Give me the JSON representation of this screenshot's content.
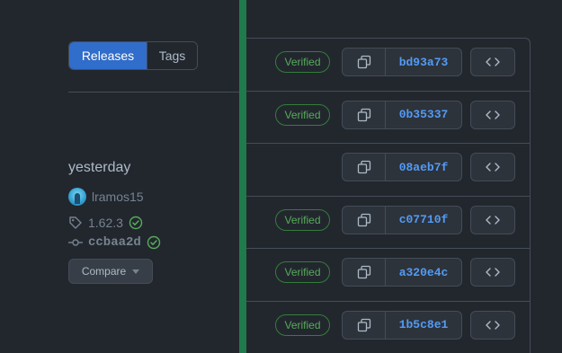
{
  "tabs": {
    "releases": "Releases",
    "tags": "Tags"
  },
  "release": {
    "date": "yesterday",
    "author": "lramos15",
    "tag": "1.62.3",
    "commit": "ccbaa2d",
    "compare_label": "Compare"
  },
  "commits": [
    {
      "verified": "Verified",
      "sha": "bd93a73"
    },
    {
      "verified": "Verified",
      "sha": "0b35337"
    },
    {
      "verified": "",
      "sha": "08aeb7f"
    },
    {
      "verified": "Verified",
      "sha": "c07710f"
    },
    {
      "verified": "Verified",
      "sha": "a320e4c"
    },
    {
      "verified": "Verified",
      "sha": "1b5c8e1"
    }
  ],
  "colors": {
    "background": "#22272e",
    "accent": "#316dca",
    "green_bar": "#1f7a4c",
    "verified": "#57ab5a",
    "link": "#539bf5"
  }
}
